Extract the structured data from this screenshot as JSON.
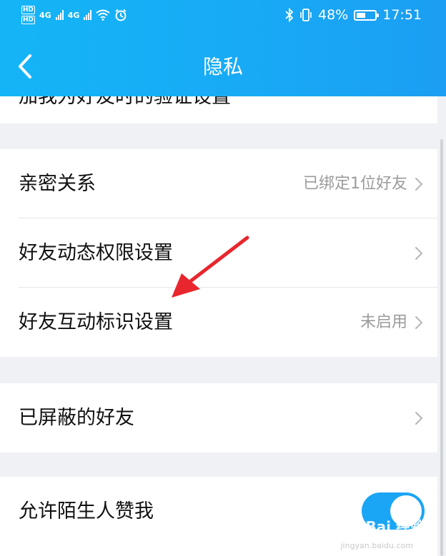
{
  "status_bar": {
    "hd1": "HD",
    "hd2": "HD",
    "net1": "4G",
    "net2": "4G",
    "battery_pct": "48%",
    "battery_fill": 0.48,
    "time": "17:51",
    "icons": [
      "hd-icon",
      "signal-icon",
      "wifi-icon",
      "alarm-icon",
      "bluetooth-icon",
      "vibrate-icon",
      "battery-icon"
    ]
  },
  "header": {
    "title": "隐私",
    "back_icon": "chevron-left-icon",
    "gradient_start": "#14b5f6",
    "gradient_end": "#1b9ef3"
  },
  "partial_row": {
    "label": "加我为好友时的验证设置"
  },
  "sections": [
    {
      "rows": [
        {
          "label": "亲密关系",
          "value": "已绑定1位好友"
        },
        {
          "label": "好友动态权限设置",
          "value": ""
        },
        {
          "label": "好友互动标识设置",
          "value": "未启用"
        }
      ]
    },
    {
      "rows": [
        {
          "label": "已屏蔽的好友",
          "value": ""
        }
      ]
    },
    {
      "rows": [
        {
          "label": "允许陌生人赞我",
          "toggle_on": true
        }
      ]
    }
  ],
  "toggle_color": "#1aa5f5",
  "annotation_color": "#e8262d",
  "watermark": {
    "text": "Bai 经验",
    "sub": "jingyan.baidu.com"
  }
}
